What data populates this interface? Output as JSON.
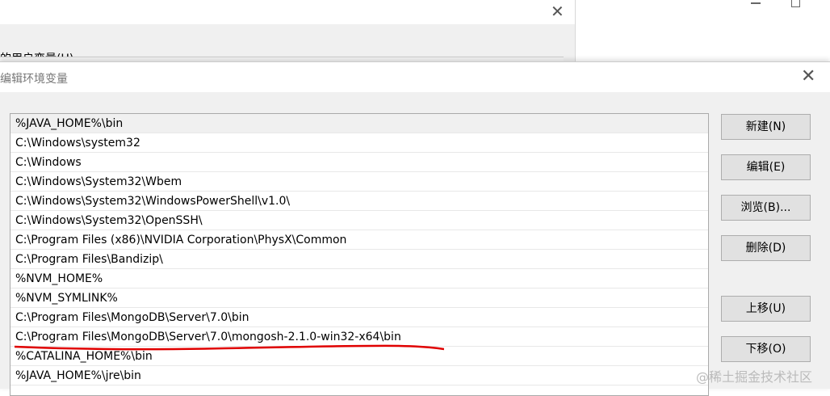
{
  "background_window": {
    "close": "✕",
    "label": "的用户变量(U)"
  },
  "dialog": {
    "title": "编辑环境变量",
    "close": "✕",
    "paths": [
      "%JAVA_HOME%\\bin",
      "C:\\Windows\\system32",
      "C:\\Windows",
      "C:\\Windows\\System32\\Wbem",
      "C:\\Windows\\System32\\WindowsPowerShell\\v1.0\\",
      "C:\\Windows\\System32\\OpenSSH\\",
      "C:\\Program Files (x86)\\NVIDIA Corporation\\PhysX\\Common",
      "C:\\Program Files\\Bandizip\\",
      "%NVM_HOME%",
      "%NVM_SYMLINK%",
      "C:\\Program Files\\MongoDB\\Server\\7.0\\bin",
      "C:\\Program Files\\MongoDB\\Server\\7.0\\mongosh-2.1.0-win32-x64\\bin",
      "%CATALINA_HOME%\\bin",
      "%JAVA_HOME%\\jre\\bin"
    ],
    "buttons": {
      "new": "新建(N)",
      "edit": "编辑(E)",
      "browse": "浏览(B)...",
      "delete": "删除(D)",
      "up": "上移(U)",
      "down": "下移(O)"
    }
  },
  "watermark": "@稀土掘金技术社区",
  "annotation_color": "#e00000"
}
